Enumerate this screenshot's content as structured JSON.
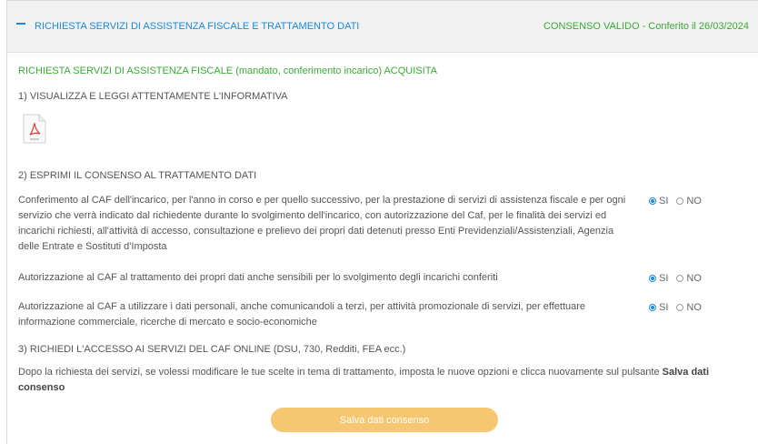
{
  "header": {
    "title": "RICHIESTA SERVIZI DI ASSISTENZA FISCALE E TRATTAMENTO DATI",
    "status": "CONSENSO VALIDO - Conferito il 26/03/2024"
  },
  "acquired": {
    "main": "RICHIESTA SERVIZI DI ASSISTENZA FISCALE",
    "detail": "(mandato, conferimento incarico) ACQUISITA"
  },
  "steps": {
    "step1": "1) VISUALIZZA E LEGGI ATTENTAMENTE L'INFORMATIVA",
    "step2": "2) ESPRIMI IL CONSENSO AL TRATTAMENTO DATI",
    "step3": "3) RICHIEDI L'ACCESSO AI SERVIZI DEL CAF ONLINE (DSU, 730, Redditi, FEA ecc.)"
  },
  "consents": [
    {
      "text": "Conferimento al CAF dell'incarico, per l'anno in corso e per quello successivo, per la prestazione di servizi di assistenza fiscale e per ogni servizio che verrà indicato dal richiedente durante lo svolgimento dell'incarico, con autorizzazione del Caf, per le finalità dei servizi ed incarichi richiesti, all'attività di accesso, consultazione e prelievo dei propri dati detenuti presso Enti Previdenziali/Assistenziali, Agenzia delle Entrate e Sostituti d'Imposta",
      "yes_label": "SI",
      "no_label": "NO",
      "selected": "SI"
    },
    {
      "text": "Autorizzazione al CAF al trattamento dei propri dati anche sensibili per lo svolgimento degli incarichi conferiti",
      "yes_label": "SI",
      "no_label": "NO",
      "selected": "SI"
    },
    {
      "text": "Autorizzazione al CAF a utilizzare i dati personali, anche comunicandoli a terzi, per attività promozionale di servizi, per effettuare informazione commerciale, ricerche di mercato e socio-economiche",
      "yes_label": "SI",
      "no_label": "NO",
      "selected": "SI"
    }
  ],
  "note": {
    "text": "Dopo la richiesta dei servizi, se volessi modificare le tue scelte in tema di trattamento, imposta le nuove opzioni e clicca nuovamente sul pulsante",
    "bold": "Salva dati consenso"
  },
  "save_button": "Salva dati consenso",
  "colors": {
    "accent_blue": "#1e88d8",
    "success_green": "#3aa935",
    "button_orange": "#f6c771"
  },
  "icons": {
    "toggle": "minus-icon",
    "document": "pdf-file-icon"
  }
}
